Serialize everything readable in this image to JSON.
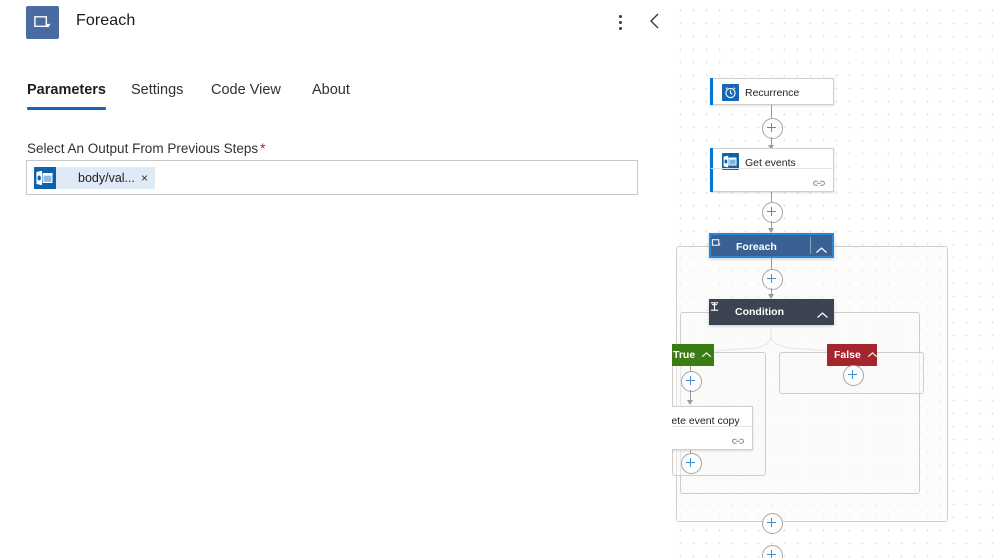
{
  "panel": {
    "title": "Foreach",
    "icon": "foreach-loop-icon",
    "more_icon": "more-vertical-icon",
    "collapse_icon": "chevron-left-icon",
    "tabs": [
      {
        "label": "Parameters",
        "active": true
      },
      {
        "label": "Settings",
        "active": false
      },
      {
        "label": "Code View",
        "active": false
      },
      {
        "label": "About",
        "active": false
      }
    ],
    "accent_color": "#1565c0",
    "field": {
      "label": "Select An Output From Previous Steps",
      "required_marker": "*",
      "token": {
        "text": "body/val...",
        "icon": "outlook-calendar-icon",
        "remove_label": "×"
      }
    }
  },
  "canvas": {
    "nodes": [
      {
        "id": "recurrence",
        "label": "Recurrence",
        "icon": "clock-icon",
        "type": "action"
      },
      {
        "id": "get-events",
        "label": "Get events",
        "icon": "outlook-calendar-icon",
        "type": "action"
      },
      {
        "id": "foreach",
        "label": "Foreach",
        "icon": "foreach-loop-icon",
        "type": "scope",
        "selected": true
      },
      {
        "id": "condition",
        "label": "Condition",
        "icon": "condition-icon",
        "type": "scope"
      },
      {
        "id": "delete-event-copy",
        "label": "lete event copy",
        "icon": "outlook-calendar-icon",
        "type": "action"
      }
    ],
    "branches": [
      {
        "id": "true",
        "label": "True",
        "color": "#3b7d12"
      },
      {
        "id": "false",
        "label": "False",
        "color": "#a4262c"
      }
    ],
    "add_button_label": "+",
    "collapse_icon": "chevron-up-icon"
  }
}
